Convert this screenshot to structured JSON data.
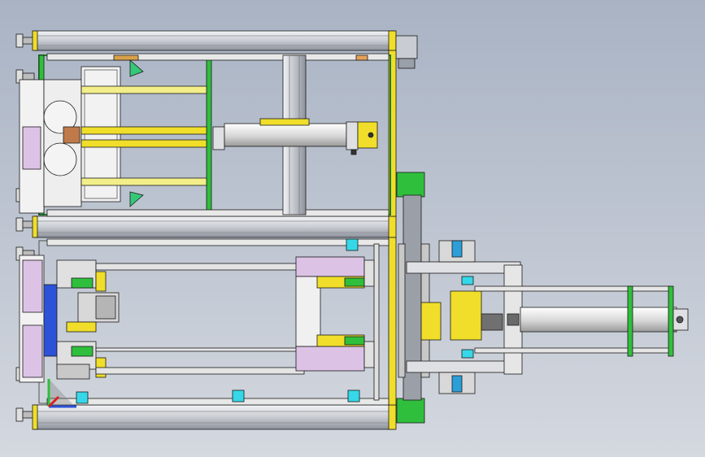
{
  "viewport": {
    "title": ""
  },
  "colors": {
    "bg_top": "#a7b2c3",
    "bg_bottom": "#d3d7de",
    "frame": "#d9dbe0",
    "frame_dark": "#6f7480",
    "rod_yellow": "#f2ee8a",
    "yellow": "#f0de2a",
    "green": "#2fbf3c",
    "green_dark": "#1f7d2a",
    "pink": "#dcc3e6",
    "cyan": "#35d8e8",
    "blue": "#2c52d8",
    "grey_part": "#c8c8c8",
    "outline": "#1a1a1a"
  },
  "icons": {
    "axis_triad": "coordinate-axis-triad-icon"
  }
}
